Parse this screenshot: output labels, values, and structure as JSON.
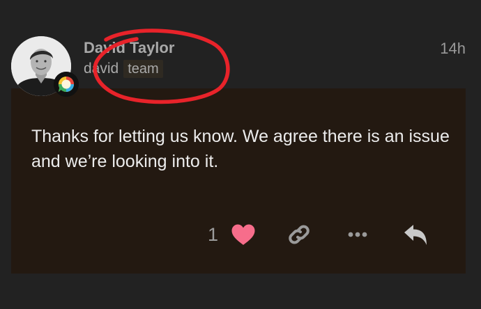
{
  "post": {
    "author": {
      "display_name": "David Taylor",
      "username": "david",
      "group_flair": "team",
      "avatar_icon": "user-avatar-photo",
      "badge_icon": "speech-bubble-badge-icon"
    },
    "time": "14h",
    "body": "Thanks for letting us know. We agree there is an issue and we’re looking into it.",
    "actions": {
      "like_count": "1",
      "like_icon": "heart-icon",
      "link_icon": "link-icon",
      "more_icon": "more-icon",
      "reply_icon": "reply-icon"
    }
  },
  "colors": {
    "page_background": "#222222",
    "post_background": "#231911",
    "heart": "#f76d8b",
    "annotation": "#e8232a"
  }
}
